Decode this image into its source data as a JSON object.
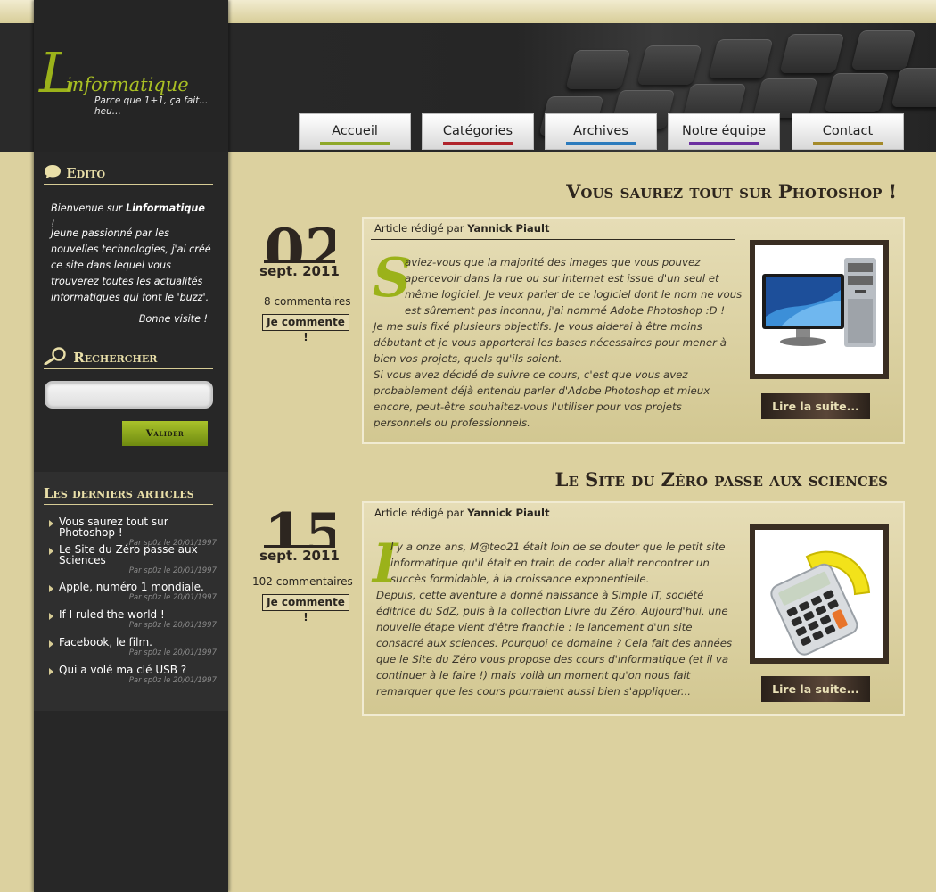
{
  "brand": {
    "logo_letter": "L",
    "logo_word": "informatique",
    "tagline": "Parce que 1+1, ça fait... heu..."
  },
  "nav": [
    {
      "label": "Accueil",
      "color": "#8ea82a"
    },
    {
      "label": "Catégories",
      "color": "#b0242c"
    },
    {
      "label": "Archives",
      "color": "#2c7bbd"
    },
    {
      "label": "Notre équipe",
      "color": "#6b2fa0"
    },
    {
      "label": "Contact",
      "color": "#a48a2a"
    }
  ],
  "sidebar": {
    "edito": {
      "title": "Edito",
      "welcome_prefix": "Bienvenue sur ",
      "welcome_site": "Linformatique",
      "welcome_suffix": " !",
      "body": "Jeune passionné par les nouvelles technologies, j'ai créé ce site dans lequel vous trouverez toutes les actualités informatiques qui font le 'buzz'.",
      "signoff": "Bonne visite !"
    },
    "search": {
      "title": "Rechercher",
      "value": "",
      "button_label": "Valider"
    },
    "latest": {
      "title": "Les derniers articles",
      "items": [
        {
          "title": "Vous saurez tout sur Photoshop !",
          "meta": "Par sp0z le 20/01/1997"
        },
        {
          "title": "Le Site du Zéro passe aux Sciences",
          "meta": "Par sp0z le 20/01/1997"
        },
        {
          "title": "Apple, numéro 1 mondiale.",
          "meta": "Par sp0z le 20/01/1997"
        },
        {
          "title": "If I ruled the world !",
          "meta": "Par sp0z le 20/01/1997"
        },
        {
          "title": "Facebook, le film.",
          "meta": "Par sp0z le 20/01/1997"
        },
        {
          "title": "Qui a volé ma clé USB ?",
          "meta": "Par sp0z le 20/01/1997"
        }
      ]
    }
  },
  "articles": [
    {
      "title": "Vous saurez tout sur Photoshop !",
      "day": "02",
      "month": "sept. 2011",
      "comments": "8 commentaires",
      "comment_button": "Je commente !",
      "byline_prefix": "Article rédigé par ",
      "author": "Yannick Piault",
      "dropcap": "S",
      "intro": "aviez-vous que la majorité des images que vous pouvez apercevoir dans la rue ou sur internet est issue d'un seul et même logiciel. Je veux parler de ce logiciel dont le nom ne vous est sûrement pas inconnu, j'ai nommé Adobe Photoshop :D !",
      "body": "Je me suis fixé plusieurs objectifs. Je vous aiderai à être moins débutant et je vous apporterai les bases nécessaires pour mener à bien vos projets, quels qu'ils soient.\nSi vous avez décidé de suivre ce cours, c'est que vous avez probablement déjà entendu parler d'Adobe Photoshop et mieux encore, peut-être souhaitez-vous l'utiliser pour vos projets personnels ou professionnels.",
      "read_more": "Lire la suite...",
      "image_icon": "desktop-computer-icon"
    },
    {
      "title": "Le Site du Zéro passe aux sciences",
      "day": "15",
      "month": "sept. 2011",
      "comments": "102 commentaires",
      "comment_button": "Je commente !",
      "byline_prefix": "Article rédigé par ",
      "author": "Yannick Piault",
      "dropcap": "I",
      "intro": "l y a onze ans, M@teo21 était loin de se douter que le petit site informatique qu'il était en train de coder allait rencontrer un succès formidable, à la croissance exponentielle.",
      "body": "Depuis, cette aventure a donné naissance à Simple IT, société éditrice du SdZ, puis à la collection Livre du Zéro. Aujourd'hui, une nouvelle étape vient d'être franchie : le lancement d'un site consacré aux sciences. Pourquoi ce domaine ? Cela fait des années que le Site du Zéro vous propose des cours d'informatique (et il va continuer à le faire !) mais voilà un moment qu'on nous fait remarquer que les cours pourraient aussi bien s'appliquer...",
      "read_more": "Lire la suite...",
      "image_icon": "calculator-icon"
    }
  ]
}
